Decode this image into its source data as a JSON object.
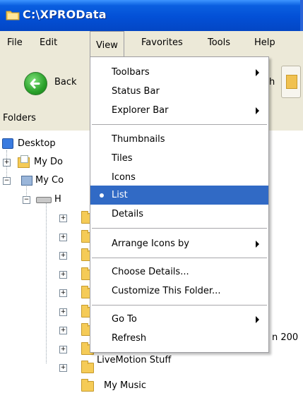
{
  "window": {
    "title": "C:\\XPROData"
  },
  "menubar": {
    "items": [
      {
        "label": "File"
      },
      {
        "label": "Edit"
      },
      {
        "label": "View"
      },
      {
        "label": "Favorites"
      },
      {
        "label": "Tools"
      },
      {
        "label": "Help"
      }
    ]
  },
  "toolbar": {
    "back_label": "Back",
    "partial_label": "h"
  },
  "folders_pane": {
    "header": "Folders"
  },
  "tree": {
    "desktop": "Desktop",
    "my_documents": "My Do",
    "my_computer": "My Co",
    "drive": "H",
    "partial_right": "n 200",
    "partial_bottom": "LiveMotion Stuff",
    "my_music": "My Music"
  },
  "view_menu": {
    "groups": [
      [
        {
          "label": "Toolbars",
          "submenu": true
        },
        {
          "label": "Status Bar",
          "submenu": false
        },
        {
          "label": "Explorer Bar",
          "submenu": true
        }
      ],
      [
        {
          "label": "Thumbnails",
          "submenu": false
        },
        {
          "label": "Tiles",
          "submenu": false
        },
        {
          "label": "Icons",
          "submenu": false
        },
        {
          "label": "List",
          "submenu": false,
          "selected": true
        },
        {
          "label": "Details",
          "submenu": false
        }
      ],
      [
        {
          "label": "Arrange Icons by",
          "submenu": true
        }
      ],
      [
        {
          "label": "Choose Details...",
          "submenu": false
        },
        {
          "label": "Customize This Folder...",
          "submenu": false
        }
      ],
      [
        {
          "label": "Go To",
          "submenu": true
        },
        {
          "label": "Refresh",
          "submenu": false
        }
      ]
    ]
  },
  "colors": {
    "title_bar": "#0350d6",
    "menu_highlight": "#316ac5",
    "chrome": "#ece9d8"
  }
}
